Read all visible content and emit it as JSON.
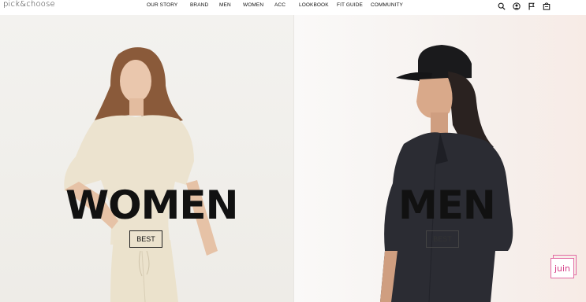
{
  "brand": {
    "logo_text": "pick&choose"
  },
  "nav": {
    "items": [
      {
        "label": "OUR STORY"
      },
      {
        "label": "BRAND"
      },
      {
        "label": "MEN"
      },
      {
        "label": "WOMEN"
      },
      {
        "label": "ACC"
      },
      {
        "label": "LOOKBOOK"
      },
      {
        "label": "FIT GUIDE"
      },
      {
        "label": "COMMUNITY"
      }
    ]
  },
  "header_icons": [
    "search-icon",
    "user-icon",
    "flag-icon",
    "cart-icon"
  ],
  "hero": {
    "women": {
      "title": "WOMEN",
      "button_label": "BEST"
    },
    "men": {
      "title": "MEN",
      "button_label": "BEST"
    }
  },
  "chat_widget": {
    "label": "juin",
    "color": "#e36ba4"
  }
}
